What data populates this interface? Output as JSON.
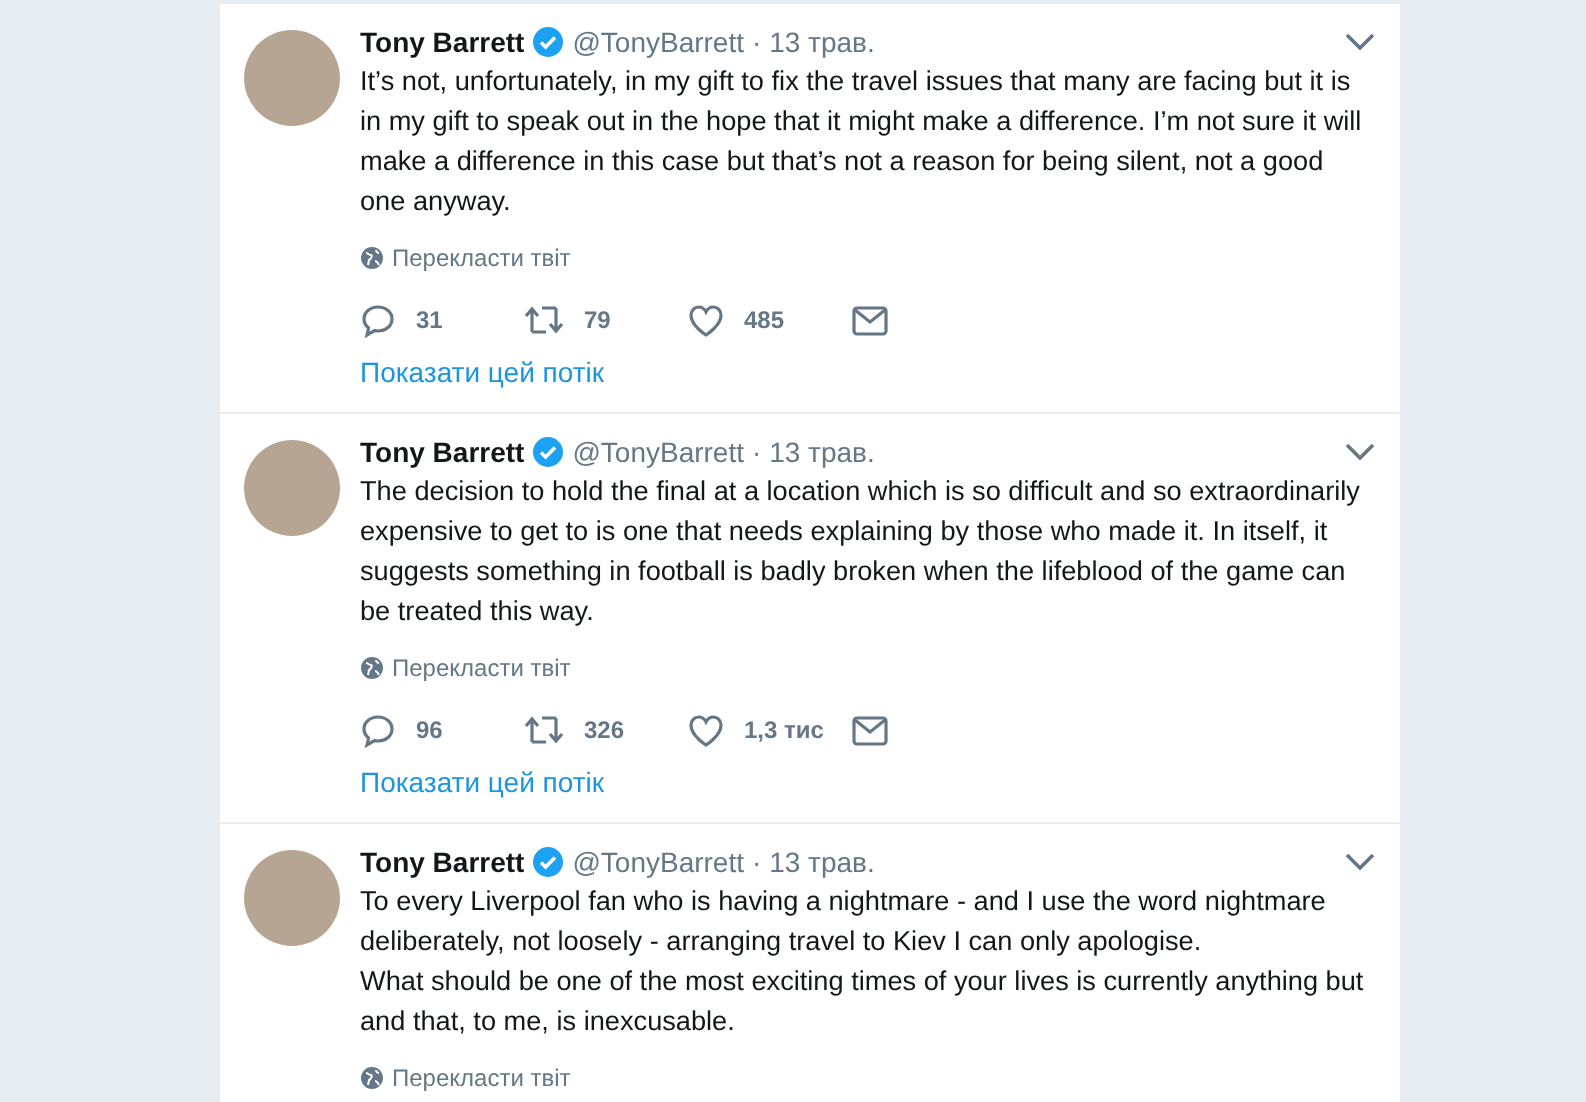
{
  "tweets": [
    {
      "name": "Tony Barrett",
      "handle": "@TonyBarrett",
      "date": "· 13 трав.",
      "text": "It’s not, unfortunately, in my gift to fix the travel issues that many are facing but it is in my gift to speak out in the hope that it might make a difference. I’m not sure it will make a difference in this case but that’s not a reason for being silent, not a good one anyway.",
      "translate": "Перекласти твіт",
      "replies": "31",
      "retweets": "79",
      "likes": "485",
      "show_thread": "Показати цей потік"
    },
    {
      "name": "Tony Barrett",
      "handle": "@TonyBarrett",
      "date": "· 13 трав.",
      "text": "The decision to hold the final at a location which is so difficult and so extraordinarily expensive to get to is one that needs explaining by those who made it. In itself, it suggests something in football is badly broken when the lifeblood of the game can be treated this way.",
      "translate": "Перекласти твіт",
      "replies": "96",
      "retweets": "326",
      "likes": "1,3 тис",
      "show_thread": "Показати цей потік"
    },
    {
      "name": "Tony Barrett",
      "handle": "@TonyBarrett",
      "date": "· 13 трав.",
      "text": "To every Liverpool fan who is having a nightmare - and I use the word nightmare deliberately, not loosely - arranging travel to Kiev I can only apologise.\nWhat should be one of the most exciting times of your lives is currently anything but and that, to me, is inexcusable.",
      "translate": "Перекласти твіт"
    }
  ]
}
